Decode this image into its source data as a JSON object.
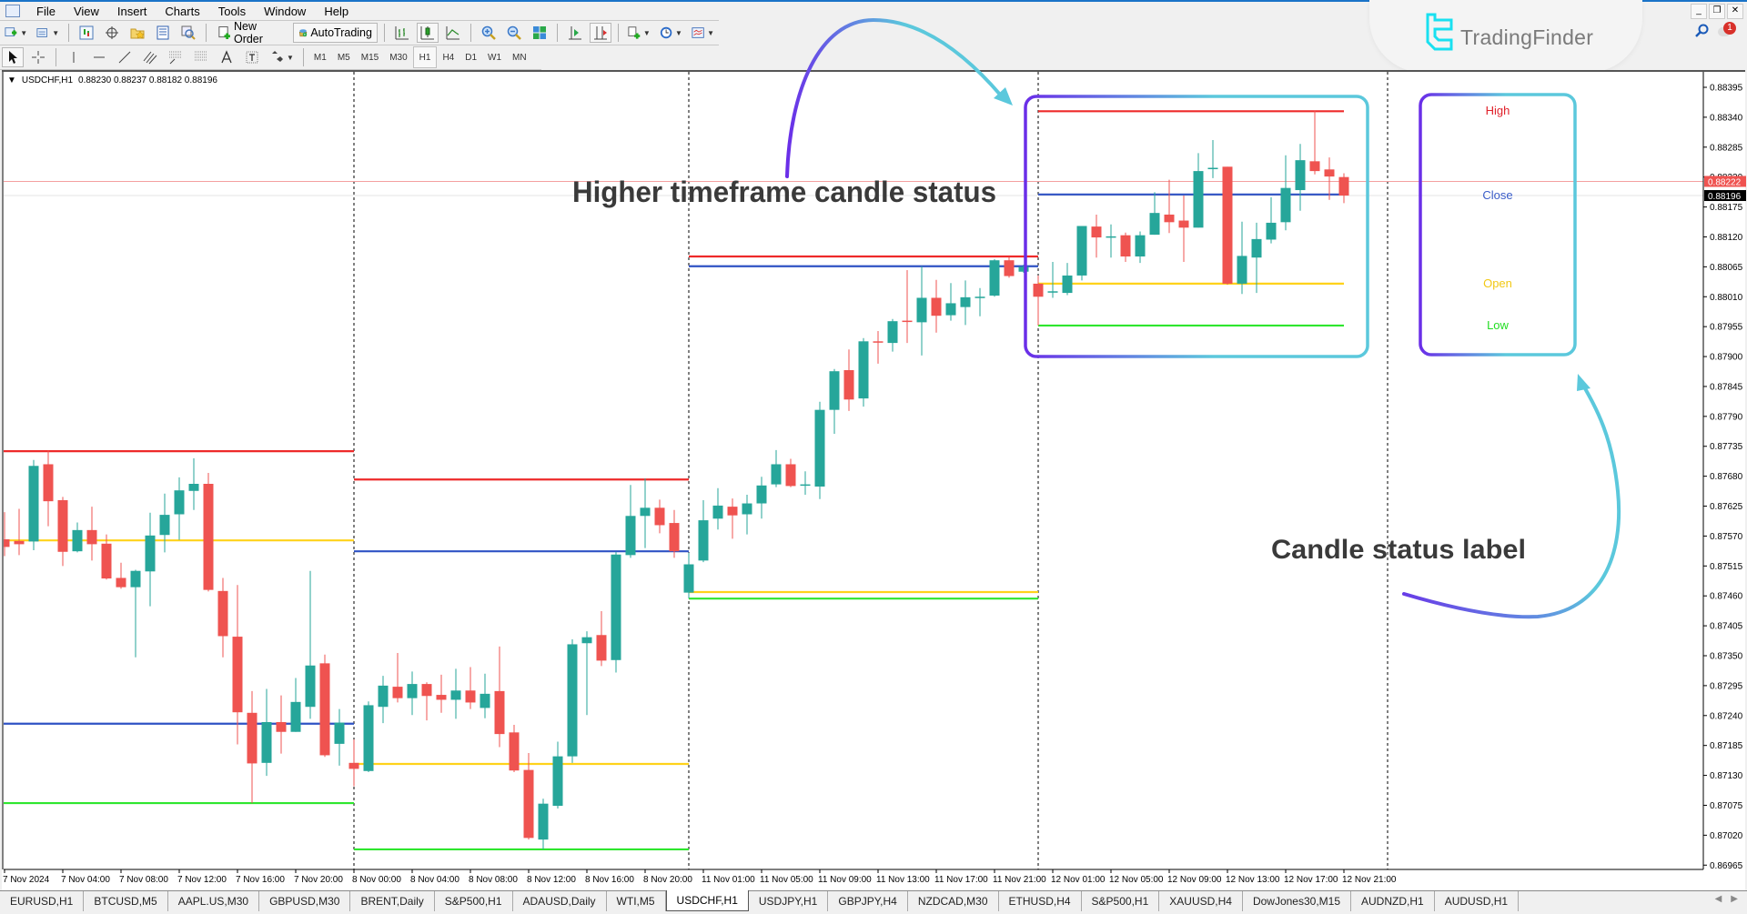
{
  "menu": [
    "File",
    "View",
    "Insert",
    "Charts",
    "Tools",
    "Window",
    "Help"
  ],
  "toolbar": {
    "new_order": "New Order",
    "autotrading": "AutoTrading"
  },
  "timeframes": [
    "M1",
    "M5",
    "M15",
    "M30",
    "H1",
    "H4",
    "D1",
    "W1",
    "MN"
  ],
  "active_timeframe": "H1",
  "window_controls": [
    "_",
    "❐",
    "✕"
  ],
  "logo": {
    "text": "TradingFinder",
    "color": "#19e0f0"
  },
  "notifications": {
    "count": "1"
  },
  "chart": {
    "symbol": "USDCHF,H1",
    "header_values": "0.88230 0.88237 0.88182 0.88196",
    "bid_price": "0.88222",
    "last_price": "0.88196",
    "bid_color": "#ef5350",
    "bull_color": "#26a69a",
    "bear_color": "#ef5350"
  },
  "chart_data": {
    "type": "candlestick",
    "timeframe": "H1",
    "ylim": [
      0.8694,
      0.8843
    ],
    "price_ticks": [
      "0.88395",
      "0.88340",
      "0.88285",
      "0.88230",
      "0.88175",
      "0.88120",
      "0.88065",
      "0.88010",
      "0.87955",
      "0.87900",
      "0.87845",
      "0.87790",
      "0.87735",
      "0.87680",
      "0.87625",
      "0.87570",
      "0.87515",
      "0.87460",
      "0.87405",
      "0.87350",
      "0.87295",
      "0.87240",
      "0.87185",
      "0.87130",
      "0.87075",
      "0.87020",
      "0.86965"
    ],
    "time_labels": [
      "7 Nov 2024",
      "7 Nov 04:00",
      "7 Nov 08:00",
      "7 Nov 12:00",
      "7 Nov 16:00",
      "7 Nov 20:00",
      "8 Nov 00:00",
      "8 Nov 04:00",
      "8 Nov 08:00",
      "8 Nov 12:00",
      "8 Nov 16:00",
      "8 Nov 20:00",
      "11 Nov 01:00",
      "11 Nov 05:00",
      "11 Nov 09:00",
      "11 Nov 13:00",
      "11 Nov 17:00",
      "11 Nov 21:00",
      "12 Nov 01:00",
      "12 Nov 05:00",
      "12 Nov 09:00",
      "12 Nov 13:00",
      "12 Nov 17:00",
      "12 Nov 21:00"
    ],
    "level_colors": {
      "high": "#ee2a2a",
      "close": "#2f52c4",
      "open": "#ffd21a",
      "low": "#2ee62e"
    },
    "days": [
      {
        "date": "7 Nov",
        "levels": {
          "high": 0.87726,
          "open": 0.87562,
          "close": 0.87225,
          "low": 0.87079
        },
        "candles": [
          [
            0.87564,
            0.87614,
            0.87533,
            0.8755
          ],
          [
            0.87561,
            0.8762,
            0.87535,
            0.87555
          ],
          [
            0.8756,
            0.8771,
            0.87544,
            0.87699
          ],
          [
            0.87702,
            0.87727,
            0.87588,
            0.87634
          ],
          [
            0.87636,
            0.87642,
            0.87515,
            0.87541
          ],
          [
            0.87542,
            0.87595,
            0.8754,
            0.87581
          ],
          [
            0.87581,
            0.87624,
            0.87525,
            0.87555
          ],
          [
            0.87556,
            0.87573,
            0.8749,
            0.87492
          ],
          [
            0.87493,
            0.87521,
            0.87473,
            0.87476
          ],
          [
            0.87476,
            0.87508,
            0.87347,
            0.87506
          ],
          [
            0.87505,
            0.87613,
            0.87441,
            0.87571
          ],
          [
            0.87572,
            0.87648,
            0.8754,
            0.87609
          ],
          [
            0.8761,
            0.87678,
            0.87563,
            0.87654
          ],
          [
            0.87653,
            0.87713,
            0.87618,
            0.87666
          ],
          [
            0.87666,
            0.87686,
            0.87468,
            0.87471
          ],
          [
            0.87469,
            0.87493,
            0.87347,
            0.87386
          ],
          [
            0.87385,
            0.8748,
            0.87187,
            0.87246
          ],
          [
            0.87245,
            0.87285,
            0.87079,
            0.87152
          ],
          [
            0.87153,
            0.87289,
            0.87129,
            0.87228
          ],
          [
            0.87228,
            0.87277,
            0.8717,
            0.8721
          ],
          [
            0.8721,
            0.87309,
            0.8721,
            0.87265
          ],
          [
            0.87256,
            0.87506,
            0.87234,
            0.87332
          ],
          [
            0.87336,
            0.87352,
            0.87164,
            0.87167
          ],
          [
            0.87188,
            0.87252,
            0.87148,
            0.87227
          ]
        ]
      },
      {
        "date": "8 Nov",
        "levels": {
          "high": 0.87674,
          "open": 0.87151,
          "close": 0.87542,
          "low": 0.86994
        },
        "candles": [
          [
            0.87153,
            0.87196,
            0.8711,
            0.87142
          ],
          [
            0.87138,
            0.87266,
            0.87136,
            0.87259
          ],
          [
            0.87256,
            0.87313,
            0.87226,
            0.87295
          ],
          [
            0.87293,
            0.87355,
            0.87264,
            0.87272
          ],
          [
            0.87272,
            0.87321,
            0.87241,
            0.87298
          ],
          [
            0.87298,
            0.87301,
            0.87231,
            0.87276
          ],
          [
            0.87278,
            0.87315,
            0.87245,
            0.87269
          ],
          [
            0.87269,
            0.87326,
            0.87234,
            0.87286
          ],
          [
            0.87286,
            0.87329,
            0.87252,
            0.87264
          ],
          [
            0.87254,
            0.87317,
            0.87235,
            0.8728
          ],
          [
            0.87285,
            0.87367,
            0.87182,
            0.87206
          ],
          [
            0.87209,
            0.87223,
            0.87136,
            0.87139
          ],
          [
            0.8714,
            0.87171,
            0.87012,
            0.87015
          ],
          [
            0.87012,
            0.87087,
            0.86994,
            0.87078
          ],
          [
            0.87074,
            0.87192,
            0.87069,
            0.87165
          ],
          [
            0.87165,
            0.8738,
            0.87153,
            0.87371
          ],
          [
            0.87373,
            0.87395,
            0.87241,
            0.87384
          ],
          [
            0.87388,
            0.87432,
            0.87331,
            0.87341
          ],
          [
            0.87342,
            0.87541,
            0.87319,
            0.87536
          ],
          [
            0.87535,
            0.87664,
            0.8753,
            0.87607
          ],
          [
            0.87607,
            0.87676,
            0.87548,
            0.87622
          ],
          [
            0.87622,
            0.87637,
            0.87575,
            0.8759
          ],
          [
            0.87594,
            0.87618,
            0.8753,
            0.87542
          ]
        ]
      },
      {
        "date": "11 Nov",
        "levels": {
          "high": 0.88084,
          "open": 0.87467,
          "close": 0.88066,
          "low": 0.87455
        },
        "candles": [
          [
            0.87466,
            0.87539,
            0.87455,
            0.87518
          ],
          [
            0.87525,
            0.87636,
            0.87522,
            0.87599
          ],
          [
            0.87602,
            0.87658,
            0.87582,
            0.87626
          ],
          [
            0.87624,
            0.87639,
            0.87565,
            0.87608
          ],
          [
            0.8761,
            0.87646,
            0.87573,
            0.8763
          ],
          [
            0.8763,
            0.87679,
            0.87602,
            0.87663
          ],
          [
            0.87665,
            0.87728,
            0.8766,
            0.87702
          ],
          [
            0.87702,
            0.87712,
            0.8766,
            0.87662
          ],
          [
            0.87664,
            0.87689,
            0.87646,
            0.87665
          ],
          [
            0.87661,
            0.87817,
            0.87638,
            0.87802
          ],
          [
            0.87802,
            0.87877,
            0.87758,
            0.87873
          ],
          [
            0.87875,
            0.87913,
            0.878,
            0.87821
          ],
          [
            0.87823,
            0.87934,
            0.87808,
            0.87928
          ],
          [
            0.87928,
            0.87947,
            0.87887,
            0.87926
          ],
          [
            0.87925,
            0.87969,
            0.87909,
            0.87965
          ],
          [
            0.87966,
            0.88059,
            0.87925,
            0.87965
          ],
          [
            0.87963,
            0.88066,
            0.87902,
            0.88008
          ],
          [
            0.88008,
            0.88041,
            0.87944,
            0.87975
          ],
          [
            0.87976,
            0.88035,
            0.87966,
            0.87998
          ],
          [
            0.87991,
            0.8804,
            0.87958,
            0.88009
          ],
          [
            0.88008,
            0.88026,
            0.87974,
            0.8801
          ],
          [
            0.88012,
            0.88079,
            0.8801,
            0.88077
          ],
          [
            0.88077,
            0.88083,
            0.88045,
            0.88048
          ],
          [
            0.88056,
            0.88069,
            0.88054,
            0.88065
          ]
        ]
      },
      {
        "date": "12 Nov",
        "levels": {
          "high": 0.88351,
          "open": 0.88034,
          "close": 0.88198,
          "low": 0.87957
        },
        "candles": [
          [
            0.88034,
            0.88049,
            0.87957,
            0.8801
          ],
          [
            0.88018,
            0.88074,
            0.88008,
            0.8802
          ],
          [
            0.88017,
            0.88072,
            0.88013,
            0.88049
          ],
          [
            0.88049,
            0.8814,
            0.8804,
            0.8814
          ],
          [
            0.88139,
            0.88161,
            0.88082,
            0.88119
          ],
          [
            0.88119,
            0.88143,
            0.88082,
            0.88121
          ],
          [
            0.88123,
            0.88128,
            0.88074,
            0.88084
          ],
          [
            0.88084,
            0.8813,
            0.88072,
            0.88123
          ],
          [
            0.88124,
            0.88202,
            0.88124,
            0.88164
          ],
          [
            0.88161,
            0.88225,
            0.88127,
            0.88147
          ],
          [
            0.8815,
            0.88196,
            0.88074,
            0.88137
          ],
          [
            0.88137,
            0.88274,
            0.88137,
            0.88241
          ],
          [
            0.88245,
            0.88298,
            0.88228,
            0.88247
          ],
          [
            0.88249,
            0.88249,
            0.88032,
            0.88034
          ],
          [
            0.88034,
            0.88148,
            0.88015,
            0.88085
          ],
          [
            0.88082,
            0.88146,
            0.88017,
            0.88116
          ],
          [
            0.88115,
            0.88193,
            0.88108,
            0.88146
          ],
          [
            0.88147,
            0.8827,
            0.88132,
            0.8821
          ],
          [
            0.88206,
            0.88291,
            0.88168,
            0.88261
          ],
          [
            0.88259,
            0.88352,
            0.88235,
            0.88241
          ],
          [
            0.88244,
            0.88266,
            0.88188,
            0.88231
          ],
          [
            0.8823,
            0.88237,
            0.88182,
            0.88196
          ]
        ]
      }
    ]
  },
  "status_labels": [
    {
      "key": "high",
      "text": "High",
      "color": "#e0202a"
    },
    {
      "key": "close",
      "text": "Close",
      "color": "#3a5cc8"
    },
    {
      "key": "open",
      "text": "Open",
      "color": "#f2c814"
    },
    {
      "key": "low",
      "text": "Low",
      "color": "#22dd22"
    }
  ],
  "annotations": {
    "htf_title": "Higher timeframe candle status",
    "label_title": "Candle status label",
    "gradient": [
      "#6a2ee8",
      "#5bc8dc"
    ]
  },
  "tabs": [
    "EURUSD,H1",
    "BTCUSD,M5",
    "AAPL.US,M30",
    "GBPUSD,M30",
    "BRENT,Daily",
    "S&P500,H1",
    "ADAUSD,Daily",
    "WTI,M5",
    "USDCHF,H1",
    "USDJPY,H1",
    "GBPJPY,H4",
    "NZDCAD,M30",
    "ETHUSD,H4",
    "S&P500,H1",
    "XAUUSD,H4",
    "DowJones30,M15",
    "AUDNZD,H1",
    "AUDUSD,H1"
  ],
  "active_tab": "USDCHF,H1"
}
